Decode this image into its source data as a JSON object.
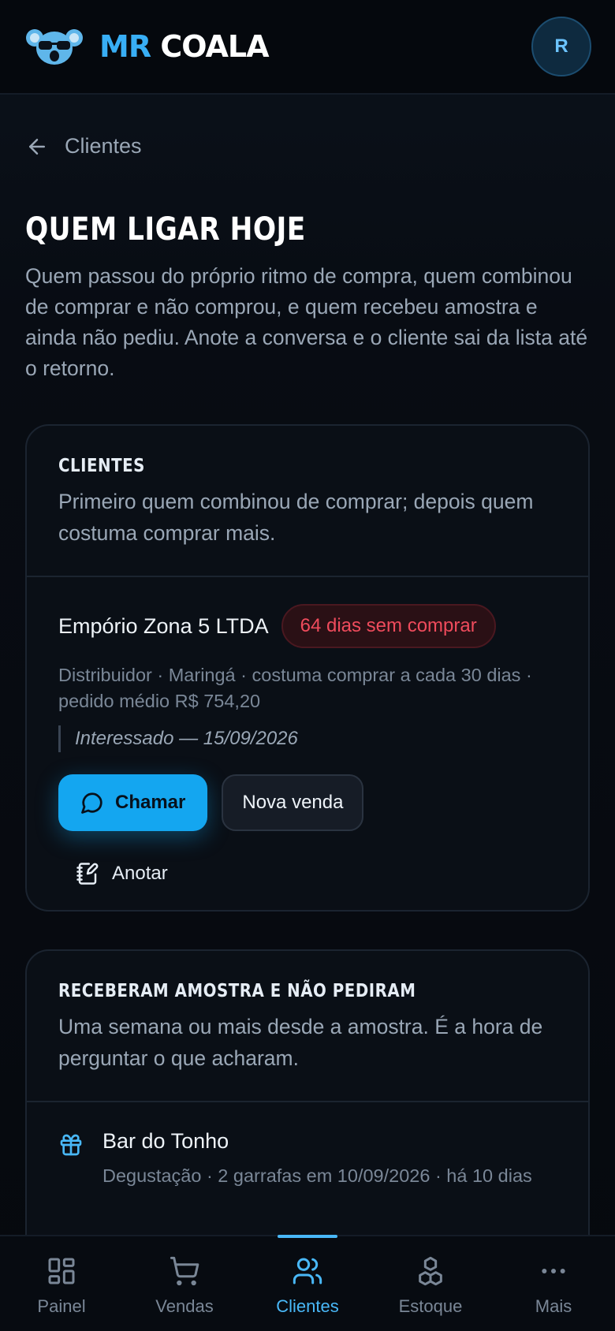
{
  "brand": {
    "mr": "MR",
    "coala": "COALA"
  },
  "user": {
    "avatar_initial": "R"
  },
  "back": {
    "label": "Clientes"
  },
  "page": {
    "title": "QUEM LIGAR HOJE",
    "description": "Quem passou do próprio ritmo de compra, quem combinou de comprar e não comprou, e quem recebeu amostra e ainda não pediu. Anote a conversa e o cliente sai da lista até o retorno."
  },
  "clients_card": {
    "title": "CLIENTES",
    "subtitle": "Primeiro quem combinou de comprar; depois quem costuma comprar mais.",
    "items": [
      {
        "name": "Empório Zona 5 LTDA",
        "badge": "64 dias sem comprar",
        "meta": "Distribuidor · Maringá · costuma comprar a cada 30 dias · pedido médio R$ 754,20",
        "note": "Interessado — 15/09/2026",
        "call_label": "Chamar",
        "new_sale_label": "Nova venda",
        "annotate_label": "Anotar"
      }
    ]
  },
  "samples_card": {
    "title": "RECEBERAM AMOSTRA E NÃO PEDIRAM",
    "subtitle": "Uma semana ou mais desde a amostra. É a hora de perguntar o que acharam.",
    "items": [
      {
        "name": "Bar do Tonho",
        "meta": "Degustação · 2 garrafas em 10/09/2026 · há 10 dias"
      }
    ]
  },
  "nav": {
    "items": [
      {
        "label": "Painel",
        "icon": "grid-icon"
      },
      {
        "label": "Vendas",
        "icon": "cart-icon"
      },
      {
        "label": "Clientes",
        "icon": "users-icon",
        "active": true
      },
      {
        "label": "Estoque",
        "icon": "boxes-icon"
      },
      {
        "label": "Mais",
        "icon": "more-icon"
      }
    ]
  },
  "colors": {
    "accent": "#14a6f0",
    "brand_blue": "#38aef5",
    "danger": "#ef4b5c",
    "background": "#070a10"
  }
}
